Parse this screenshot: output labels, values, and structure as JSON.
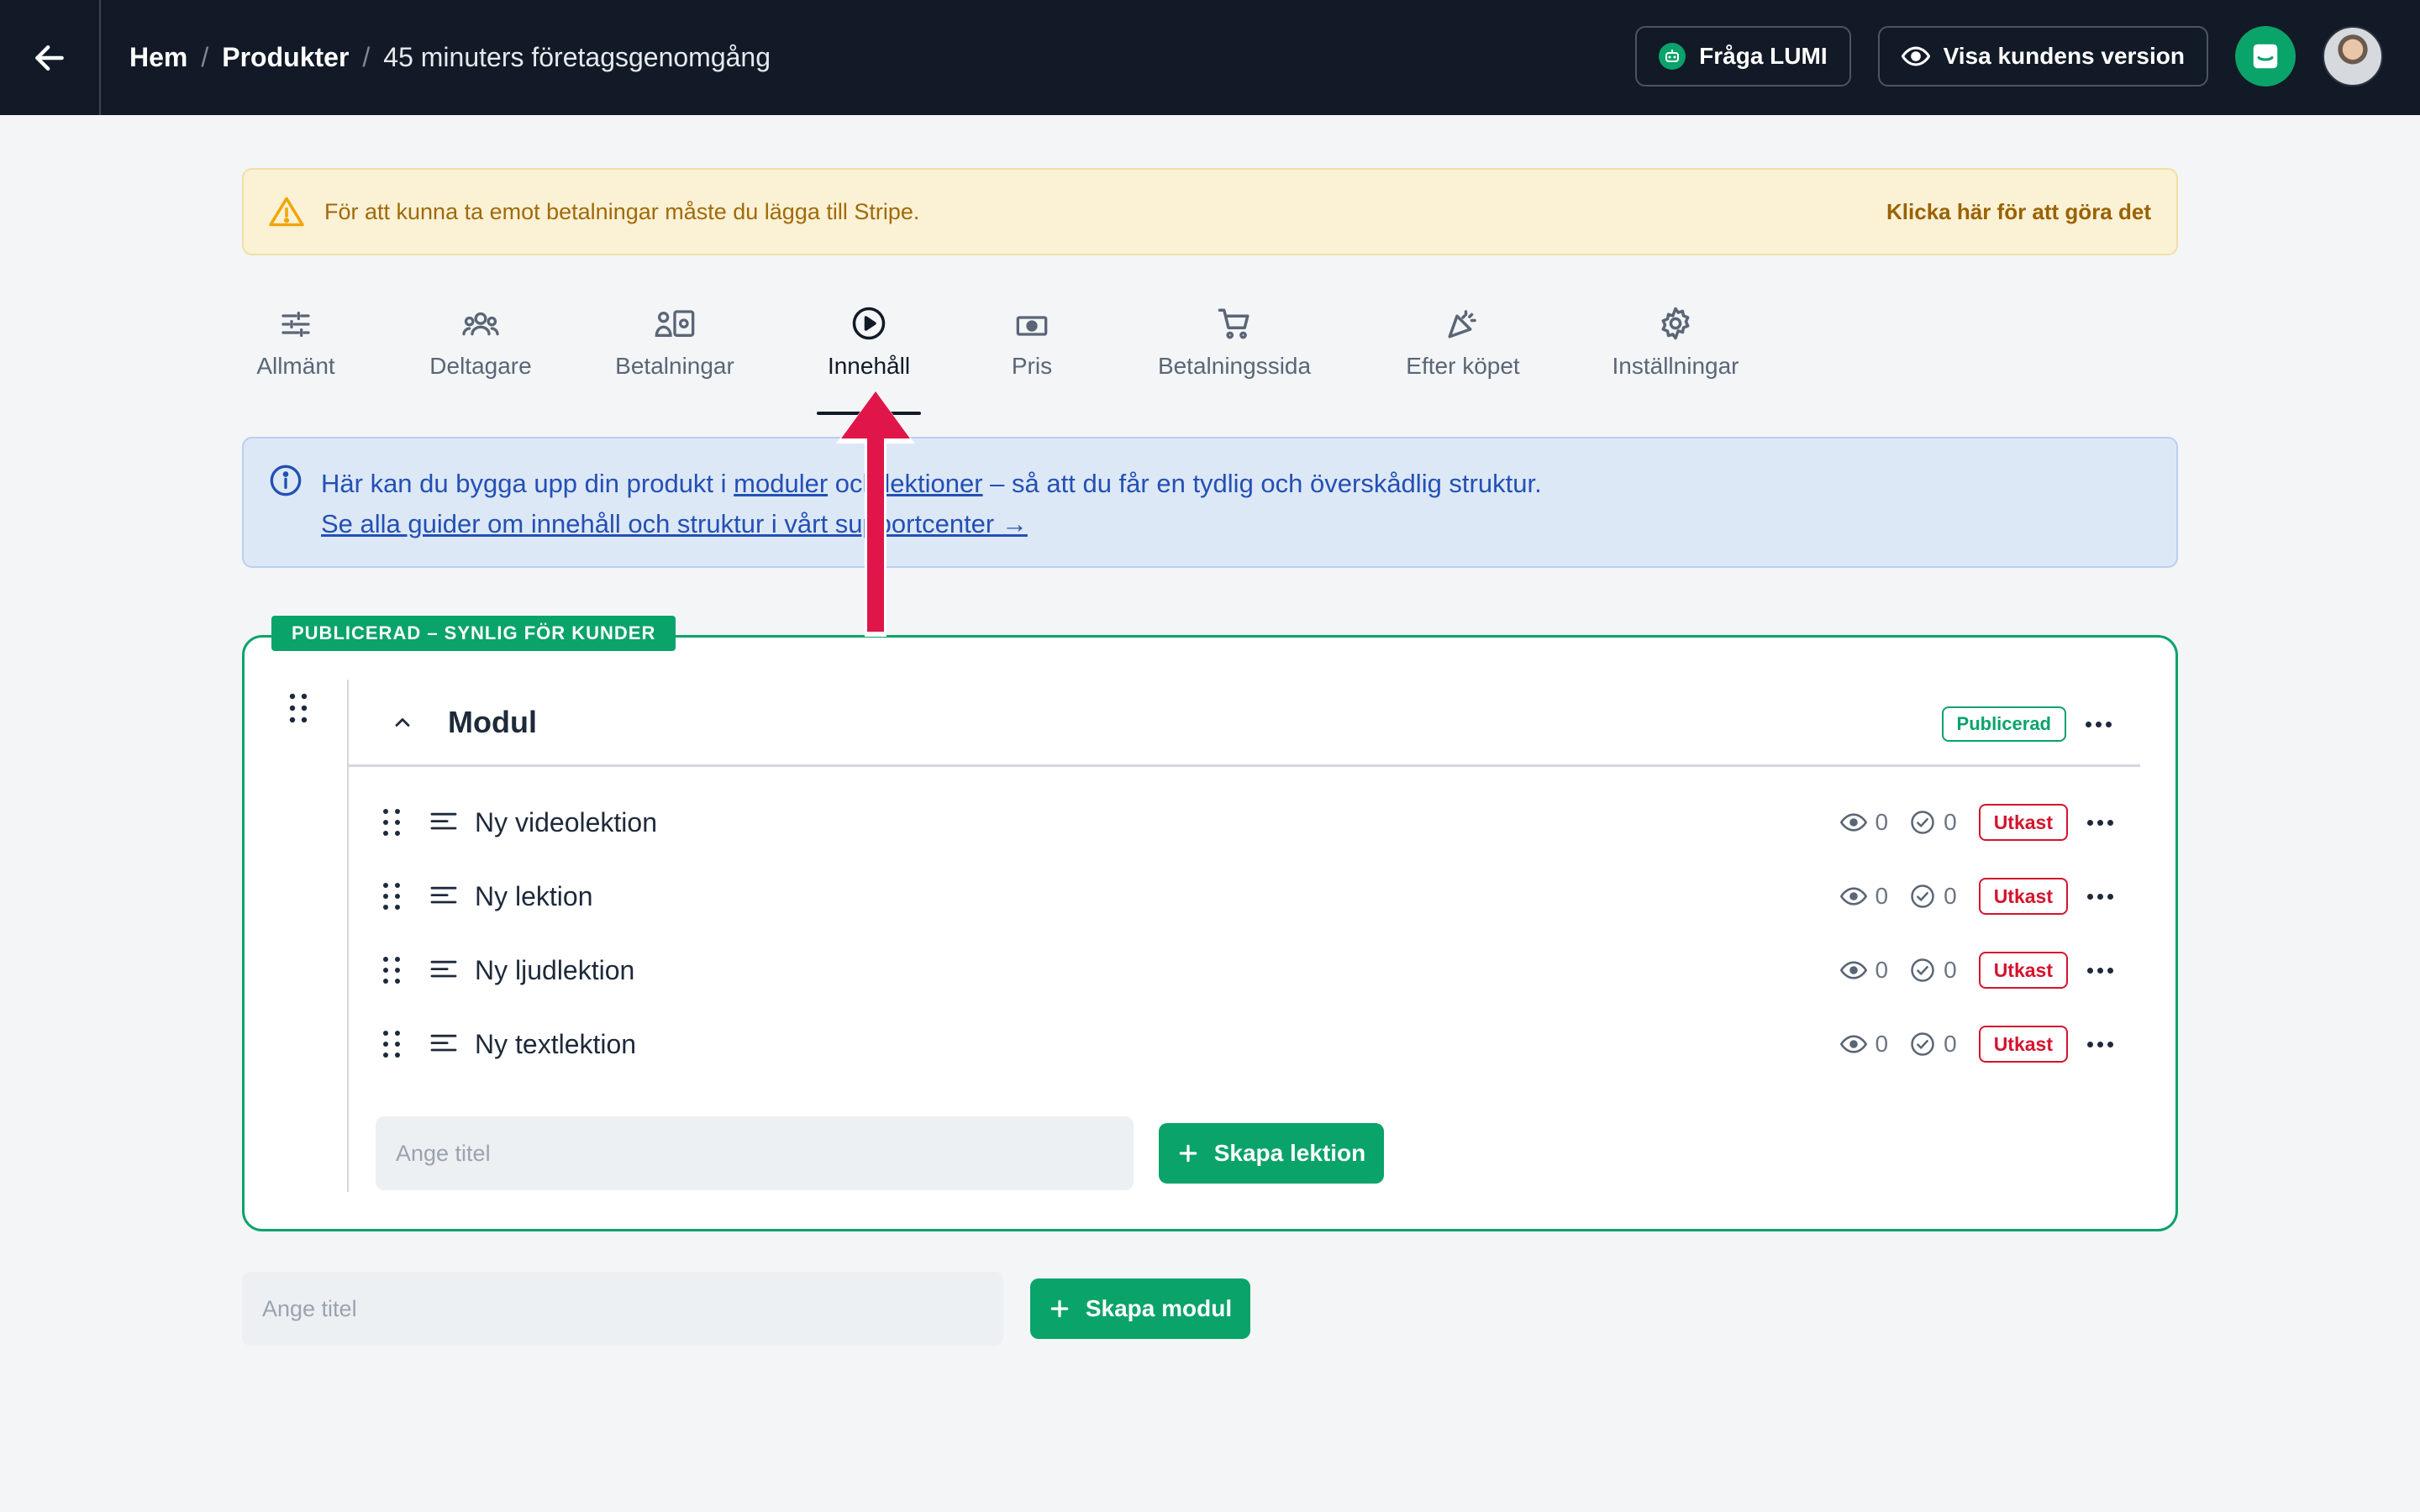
{
  "header": {
    "breadcrumb": [
      "Hem",
      "Produkter",
      "45 minuters företagsgenomgång"
    ],
    "ask_button": "Fråga LUMI",
    "preview_button": "Visa kundens version"
  },
  "warning": {
    "text": "För att kunna ta emot betalningar måste du lägga till Stripe.",
    "link": "Klicka här för att göra det"
  },
  "tabs": [
    {
      "label": "Allmänt",
      "icon": "sliders-icon"
    },
    {
      "label": "Deltagare",
      "icon": "people-icon"
    },
    {
      "label": "Betalningar",
      "icon": "payments-icon"
    },
    {
      "label": "Innehåll",
      "icon": "play-circle-icon",
      "active": true
    },
    {
      "label": "Pris",
      "icon": "money-icon"
    },
    {
      "label": "Betalningssida",
      "icon": "cart-icon"
    },
    {
      "label": "Efter köpet",
      "icon": "party-icon"
    },
    {
      "label": "Inställningar",
      "icon": "gear-icon"
    }
  ],
  "info": {
    "line1_a": "Här kan du bygga upp din produkt i ",
    "link_modules": "moduler",
    "line1_b": " och ",
    "link_lessons": "lektioner",
    "line1_c": " – så att du får en tydlig och överskådlig struktur.",
    "line2_link": "Se alla guider om innehåll och struktur i vårt supportcenter →"
  },
  "module": {
    "tag": "PUBLICERAD – SYNLIG FÖR KUNDER",
    "title": "Modul",
    "status": "Publicerad",
    "lessons": [
      {
        "name": "Ny videolektion",
        "views": "0",
        "completed": "0",
        "status": "Utkast"
      },
      {
        "name": "Ny lektion",
        "views": "0",
        "completed": "0",
        "status": "Utkast"
      },
      {
        "name": "Ny ljudlektion",
        "views": "0",
        "completed": "0",
        "status": "Utkast"
      },
      {
        "name": "Ny textlektion",
        "views": "0",
        "completed": "0",
        "status": "Utkast"
      }
    ],
    "lesson_input_placeholder": "Ange titel",
    "create_lesson_button": "Skapa lektion"
  },
  "module_input_placeholder": "Ange titel",
  "create_module_button": "Skapa modul",
  "colors": {
    "accent_green": "#0aa36a",
    "draft_red": "#d4142e",
    "topbar": "#111a26",
    "arrow_red": "#e0164a"
  }
}
